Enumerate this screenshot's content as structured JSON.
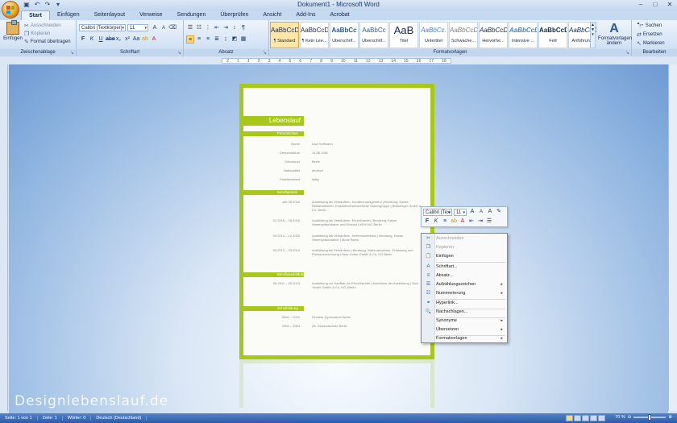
{
  "window": {
    "title": "Dokument1 - Microsoft Word"
  },
  "tabs": [
    "Start",
    "Einfügen",
    "Seitenlayout",
    "Verweise",
    "Sendungen",
    "Überprüfen",
    "Ansicht",
    "Add-Ins",
    "Acrobat"
  ],
  "clipboard": {
    "paste": "Einfügen",
    "cut": "Ausschneiden",
    "copy": "Kopieren",
    "format_painter": "Format übertragen",
    "label": "Zwischenablage"
  },
  "font": {
    "name": "Calibri (Textkörper)",
    "size": "11",
    "label": "Schriftart"
  },
  "paragraph": {
    "label": "Absatz"
  },
  "styles": {
    "label": "Formatvorlagen",
    "items": [
      {
        "preview": "AaBbCcDc",
        "name": "¶ Standard",
        "active": true
      },
      {
        "preview": "AaBbCcDc",
        "name": "¶ Kein Lee..."
      },
      {
        "preview": "AaBbCc",
        "name": "Überschrif..."
      },
      {
        "preview": "AaBbCc",
        "name": "Überschrif..."
      },
      {
        "preview": "AaB",
        "name": "Titel",
        "big": true
      },
      {
        "preview": "AaBbCc.",
        "name": "Untertitel"
      },
      {
        "preview": "AaBbCcDc",
        "name": "Schwache..."
      },
      {
        "preview": "AaBbCcDc",
        "name": "Hervorhe..."
      },
      {
        "preview": "AaBbCcDc",
        "name": "Intensive ..."
      },
      {
        "preview": "AaBbCcDc",
        "name": "Fett"
      },
      {
        "preview": "AaBbCcDc",
        "name": "Anführun..."
      }
    ],
    "change": "Formatvorlagen ändern"
  },
  "editing": {
    "label": "Bearbeiten",
    "find": "Suchen",
    "replace": "Ersetzen",
    "select": "Markieren"
  },
  "ruler": {
    "ticks": [
      "2",
      "1",
      "1",
      "2",
      "3",
      "4",
      "5",
      "6",
      "7",
      "8",
      "9",
      "10",
      "11",
      "12",
      "13",
      "14",
      "15",
      "16",
      "17",
      "18"
    ]
  },
  "document": {
    "title": "Lebenslauf",
    "sections": {
      "personal": "Persönliches",
      "career": "Berufspraxis",
      "training": "Berufsausbildung",
      "school": "Schulbildung"
    },
    "personal_rows": [
      {
        "label": "Name",
        "value": "Lisa Hoffmann"
      },
      {
        "label": "Geburtsdatum",
        "value": "14.08.1981"
      },
      {
        "label": "Geburtsort",
        "value": "Berlin"
      },
      {
        "label": "Nationalität",
        "value": "deutsch"
      },
      {
        "label": "Familienstand",
        "value": "ledig"
      }
    ],
    "career_rows": [
      {
        "label": "seit 08.2016",
        "value": "Ausbildung als Verkäuferin, Kundenmanagement | Beratung, Kasse, Reklamationen, Einkaufsverantwortliche Warengruppe | Brauninger GmbH & Co. Berlin"
      },
      {
        "label": "01.2016 – 08.2016",
        "value": "Ausbildung als Verkäuferin, Einzelhandel | Beratung, Kasse, Warenpräsentation und Einkauf | WDH AG Berlin"
      },
      {
        "label": "09.2014 – 12.2015",
        "value": "Ausbildung als Verkäuferin, Herrenkonfektion | Beratung, Kasse, Warenpräsentation | Mode Berlin"
      },
      {
        "label": "09.2013 – 03.2014",
        "value": "Ausbildung als Verkäuferin | Beratung, Warenannahme, Erfassung und Preisauszeichnung | New Yorker GmbH & Co. KG Berlin"
      }
    ],
    "training_rows": [
      {
        "label": "08.2011 – 05.2013",
        "value": "Ausbildung zur Kauffrau im Einzelhandel | Abschluss der Ausbildung | New Yorker GmbH & Co. KG, Berlin"
      }
    ],
    "school_rows": [
      {
        "label": "2004 – 2010",
        "value": "Einstein-Gymnasium Berlin"
      },
      {
        "label": "2002 – 2004",
        "value": "Alt. Gesamtschule Berlin"
      }
    ]
  },
  "mini_toolbar": {
    "font": "Calibri (Tex",
    "size": "11"
  },
  "context_menu": [
    {
      "label": "Ausschneiden",
      "icon": "cut-icon",
      "glyph": "✂",
      "disabled": true
    },
    {
      "label": "Kopieren",
      "icon": "copy-icon",
      "glyph": "❐",
      "disabled": true
    },
    {
      "label": "Einfügen",
      "icon": "paste-icon",
      "glyph": "📋"
    },
    {
      "sep": true
    },
    {
      "label": "Schriftart...",
      "icon": "font-icon",
      "glyph": "A"
    },
    {
      "label": "Absatz...",
      "icon": "paragraph-icon",
      "glyph": "≡"
    },
    {
      "label": "Aufzählungszeichen",
      "icon": "bullets-icon",
      "glyph": "☰",
      "submenu": true
    },
    {
      "label": "Nummerierung",
      "icon": "numbering-icon",
      "glyph": "☷",
      "submenu": true
    },
    {
      "sep": true
    },
    {
      "label": "Hyperlink...",
      "icon": "hyperlink-icon",
      "glyph": "⚭"
    },
    {
      "sep": true
    },
    {
      "label": "Nachschlagen...",
      "icon": "lookup-icon",
      "glyph": "🔍"
    },
    {
      "sep": true
    },
    {
      "label": "Synonyme",
      "icon": "",
      "glyph": "",
      "submenu": true
    },
    {
      "label": "Übersetzen",
      "icon": "",
      "glyph": "",
      "submenu": true
    },
    {
      "sep": true
    },
    {
      "label": "Formatvorlagen",
      "icon": "",
      "glyph": "",
      "submenu": true
    }
  ],
  "watermark": "Designlebenslauf.de",
  "status": {
    "page": "Seite: 1 von 1",
    "line": "Zeile: 1",
    "words": "Wörter: 0",
    "lang": "Deutsch (Deutschland)",
    "zoom": "70 %"
  }
}
